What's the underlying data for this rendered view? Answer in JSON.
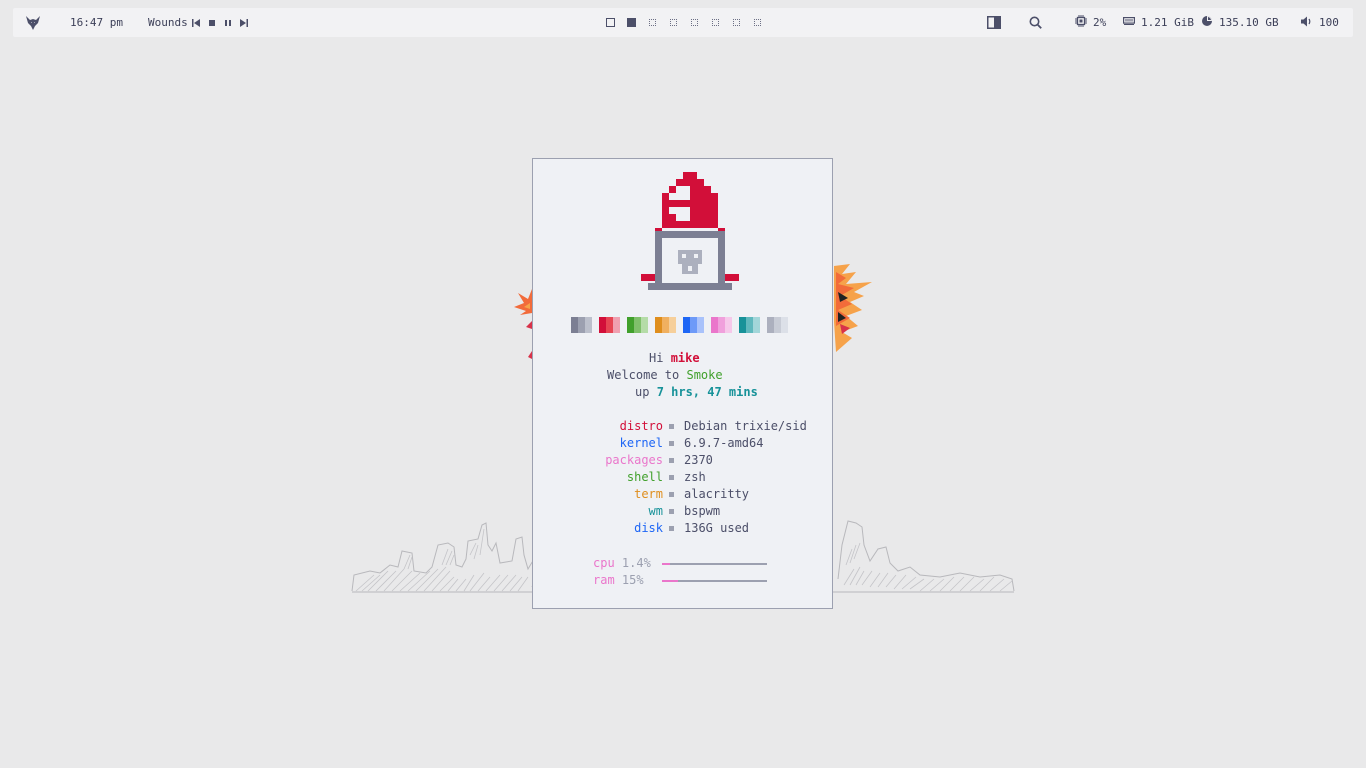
{
  "topbar": {
    "clock": "16:47 pm",
    "now_playing": "Wounds",
    "workspaces": [
      {
        "state": "occupied"
      },
      {
        "state": "focused"
      },
      {
        "state": "empty"
      },
      {
        "state": "empty"
      },
      {
        "state": "empty"
      },
      {
        "state": "empty"
      },
      {
        "state": "empty"
      },
      {
        "state": "empty"
      }
    ],
    "cpu": "2%",
    "ram": "1.21 GiB",
    "disk": "135.10 GB",
    "volume": "100",
    "icons": {
      "logo": "fox-logo-icon",
      "prev": "skip-back-icon",
      "stop": "stop-icon",
      "pause": "pause-icon",
      "next": "skip-forward-icon",
      "layout": "layout-icon",
      "search": "search-icon",
      "cpu": "cpu-chip-icon",
      "ram": "memory-icon",
      "disk": "pie-chart-icon",
      "volume": "speaker-icon"
    }
  },
  "fetch": {
    "greeting_hi": "Hi",
    "user": "mike",
    "welcome": "Welcome to",
    "host": "Smoke",
    "up_prefix": "up",
    "uptime": "7 hrs, 47 mins",
    "info": [
      {
        "key": "distro",
        "value": "Debian trixie/sid",
        "color": "#d20f39"
      },
      {
        "key": "kernel",
        "value": "6.9.7-amd64",
        "color": "#1e66f5"
      },
      {
        "key": "packages",
        "value": "2370",
        "color": "#ea76cb"
      },
      {
        "key": "shell",
        "value": "zsh",
        "color": "#40a02b"
      },
      {
        "key": "term",
        "value": "alacritty",
        "color": "#df8e1d"
      },
      {
        "key": "wm",
        "value": "bspwm",
        "color": "#179299"
      },
      {
        "key": "disk",
        "value": "136G used",
        "color": "#1e66f5"
      }
    ],
    "cpu_label": "cpu",
    "cpu_value": "1.4%",
    "cpu_fraction": 0.014,
    "ram_label": "ram",
    "ram_value": "15%",
    "ram_fraction": 0.15,
    "palette": [
      [
        "#7c7f93",
        "#9ca0b0",
        "#bcc0cc"
      ],
      [
        "#d20f39",
        "#e64553",
        "#f0a0b0"
      ],
      [
        "#40a02b",
        "#7fc06a",
        "#b5dca8"
      ],
      [
        "#df8e1d",
        "#f0b060",
        "#f6cf9a"
      ],
      [
        "#1e66f5",
        "#6d9af8",
        "#a9c2fb"
      ],
      [
        "#ea76cb",
        "#f0a0dc",
        "#f6c8ea"
      ],
      [
        "#179299",
        "#5fb8bd",
        "#a2d6d9"
      ],
      [
        "#acb0be",
        "#c8ccd6",
        "#dce0e8"
      ]
    ],
    "colors": {
      "accent_red": "#d20f39",
      "accent_green": "#40a02b",
      "accent_teal": "#179299",
      "text": "#4c4f69"
    }
  }
}
